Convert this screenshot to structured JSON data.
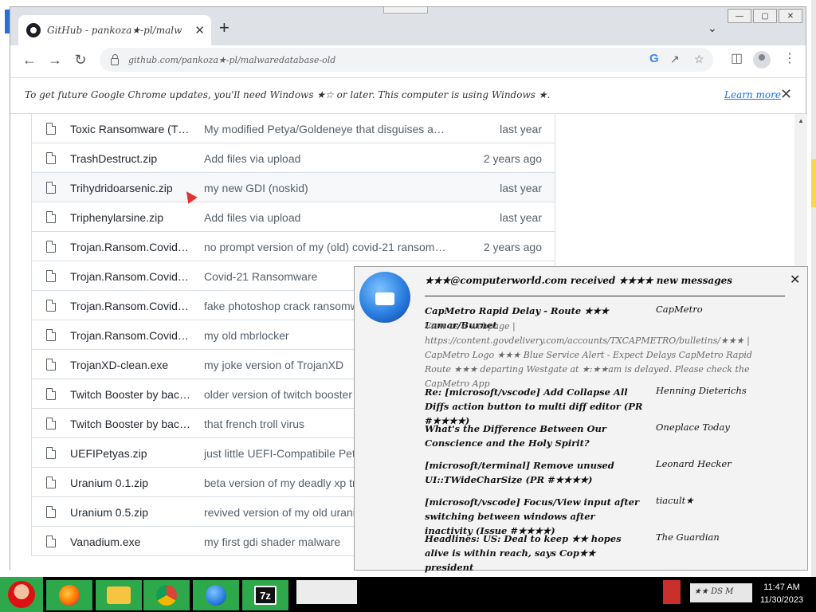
{
  "browser": {
    "tab_title": "GitHub - pankoza★-pl/malwaredatabase",
    "tab_close": "✕",
    "new_tab": "+",
    "tab_dropdown": "⌄",
    "window_buttons": [
      "—",
      "▢",
      "✕"
    ],
    "url": "github.com/pankoza★-pl/malwaredatabase-old",
    "infobar_text": "To get future Google Chrome updates, you'll need Windows ★☆ or later. This computer is using Windows ★.",
    "learn_more": "Learn more",
    "infobar_close": "✕"
  },
  "files": [
    {
      "name": "Toxic Ransomware (T…",
      "message": "My modified Petya/Goldeneye that disguises a…",
      "date": "last year"
    },
    {
      "name": "TrashDestruct.zip",
      "message": "Add files via upload",
      "date": "2 years ago"
    },
    {
      "name": "Trihydridoarsenic.zip",
      "message": "my new GDI (noskid)",
      "date": "last year"
    },
    {
      "name": "Triphenylarsine.zip",
      "message": "Add files via upload",
      "date": "last year"
    },
    {
      "name": "Trojan.Ransom.Covid…",
      "message": "no prompt version of my (old) covid-21 ransom…",
      "date": "2 years ago"
    },
    {
      "name": "Trojan.Ransom.Covid…",
      "message": "Covid-21 Ransomware",
      "date": ""
    },
    {
      "name": "Trojan.Ransom.Covid…",
      "message": "fake photoshop crack ransomw",
      "date": ""
    },
    {
      "name": "Trojan.Ransom.Covid…",
      "message": "my old mbrlocker",
      "date": ""
    },
    {
      "name": "TrojanXD-clean.exe",
      "message": "my joke version of TrojanXD",
      "date": ""
    },
    {
      "name": "Twitch Booster by bac…",
      "message": "older version of twitch booster",
      "date": ""
    },
    {
      "name": "Twitch Booster by bac…",
      "message": "that french troll virus",
      "date": ""
    },
    {
      "name": "UEFIPetyas.zip",
      "message": "just little UEFI-Compatibile Pet",
      "date": ""
    },
    {
      "name": "Uranium 0.1.zip",
      "message": "beta version of my deadly xp tr",
      "date": ""
    },
    {
      "name": "Uranium 0.5.zip",
      "message": "revived version of my old urani",
      "date": ""
    },
    {
      "name": "Vanadium.exe",
      "message": "my first gdi shader malware",
      "date": ""
    }
  ],
  "notification": {
    "header": "★★★@computerworld.com received ★★★★ new messages",
    "close": "✕",
    "messages": [
      {
        "subject": "CapMetro Rapid Delay - Route ★★★ Lamar/Burnet",
        "from": "CapMetro",
        "preview": "View as a webpage | https://content.govdelivery.com/accounts/TXCAPMETRO/bulletins/★★★ | CapMetro Logo ★★★ Blue Service Alert - Expect Delays CapMetro Rapid Route ★★★ departing Westgate at ★:★★am is delayed. Please check the CapMetro App"
      },
      {
        "subject": "Re: [microsoft/vscode] Add Collapse All Diffs action button to multi diff editor (PR #★★★★)",
        "from": "Henning Dieterichs",
        "preview": ""
      },
      {
        "subject": "What's the Difference Between Our Conscience and the Holy Spirit?",
        "from": "Oneplace Today",
        "preview": ""
      },
      {
        "subject": "[microsoft/terminal] Remove unused UI::TWideCharSize (PR #★★★★)",
        "from": "Leonard Hecker",
        "preview": ""
      },
      {
        "subject": "[microsoft/vscode] Focus/View input after switching between windows after inactivity (Issue #★★★★)",
        "from": "tiacult★",
        "preview": ""
      },
      {
        "subject": "Headlines: US: Deal to keep ★★ hopes alive is within reach, says Cop★★ president",
        "from": "The Guardian",
        "preview": ""
      }
    ]
  },
  "taskbar": {
    "tray_label": "★★ DS M",
    "time": "11:47 AM",
    "date": "11/30/2023",
    "apps": [
      "santa",
      "firefox",
      "explorer",
      "chrome",
      "thunderbird",
      "7z"
    ]
  },
  "colors": {
    "taskbar_item": "#2da84a",
    "link": "#1a73e8"
  }
}
